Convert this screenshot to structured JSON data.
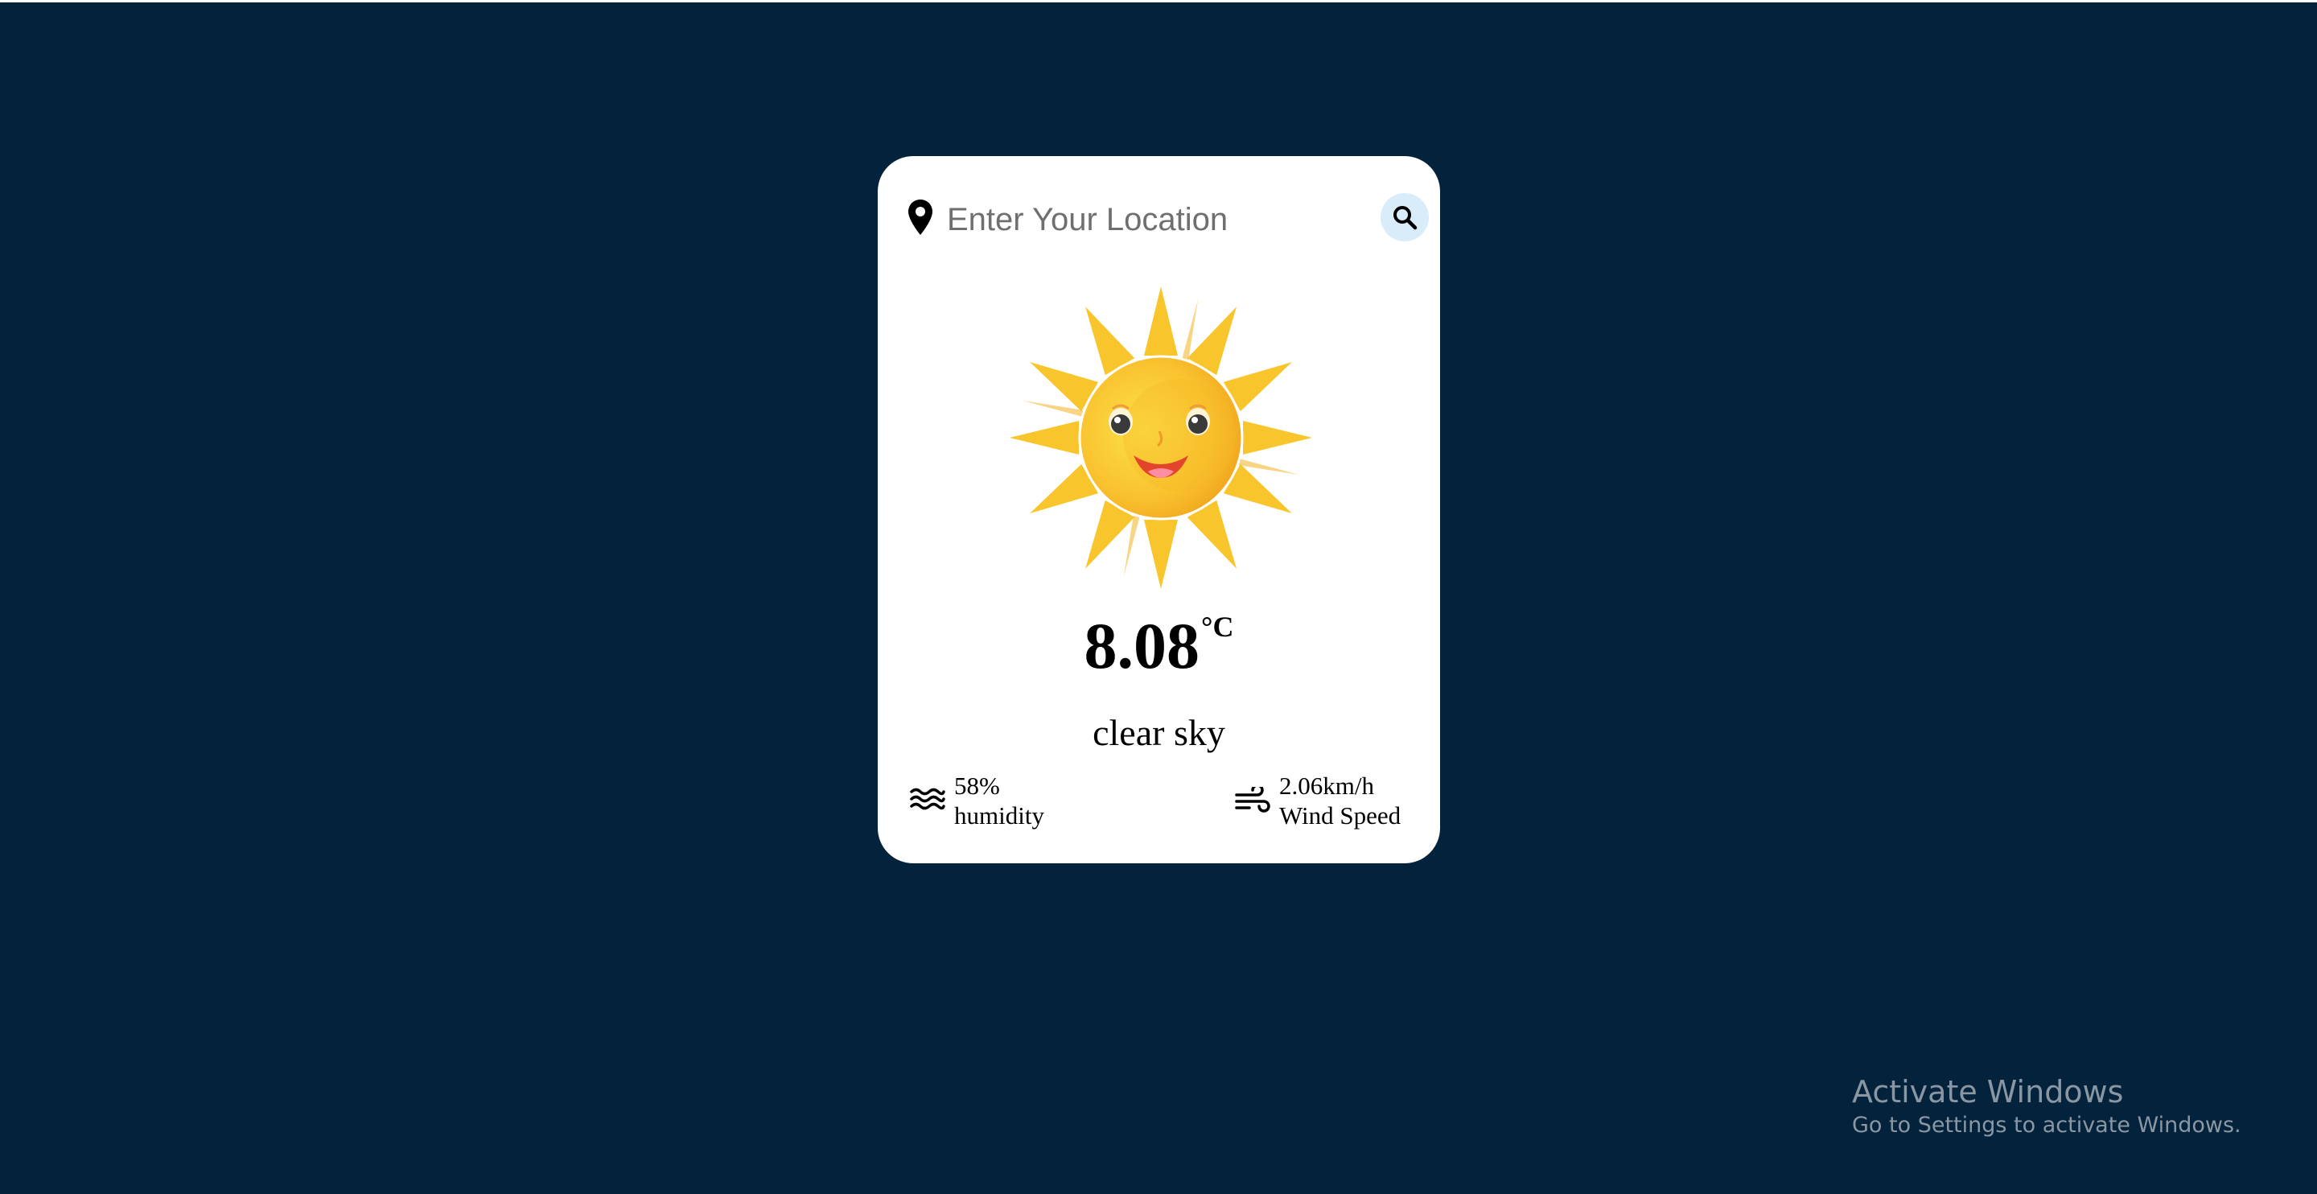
{
  "search": {
    "placeholder": "Enter Your Location",
    "value": ""
  },
  "weather": {
    "temperature": "8.08",
    "unit": "°C",
    "description": "clear sky",
    "icon": "smiling-sun-icon",
    "humidity": {
      "value": "58%",
      "label": "humidity",
      "icon": "water-waves-icon"
    },
    "wind": {
      "value": "2.06km/h",
      "label": "Wind Speed",
      "icon": "wind-icon"
    }
  },
  "watermark": {
    "title": "Activate Windows",
    "subtitle": "Go to Settings to activate Windows."
  },
  "colors": {
    "background": "#03233d",
    "card": "#ffffff",
    "search_button": "#d8ecfa",
    "sun": "#f9c22e"
  }
}
